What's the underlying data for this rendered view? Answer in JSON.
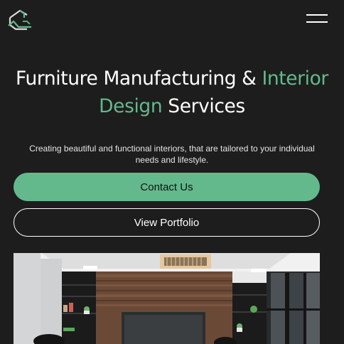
{
  "header": {
    "logo_icon": "house-outline-logo-icon",
    "menu_icon": "hamburger-menu-icon"
  },
  "hero": {
    "title_part1": "Furniture Manufacturing & ",
    "title_accent1": "Interior",
    "title_accent2": "Design",
    "title_part2": " Services",
    "subtitle": "Creating beautiful and functional interiors, that are tailored to your individual needs and lifestyle."
  },
  "buttons": {
    "primary_label": "Contact Us",
    "secondary_label": "View Portfolio"
  },
  "image": {
    "subject": "interior-room-photo"
  },
  "colors": {
    "background": "#1d1d1d",
    "accent": "#63b98c",
    "text": "#ffffff"
  }
}
